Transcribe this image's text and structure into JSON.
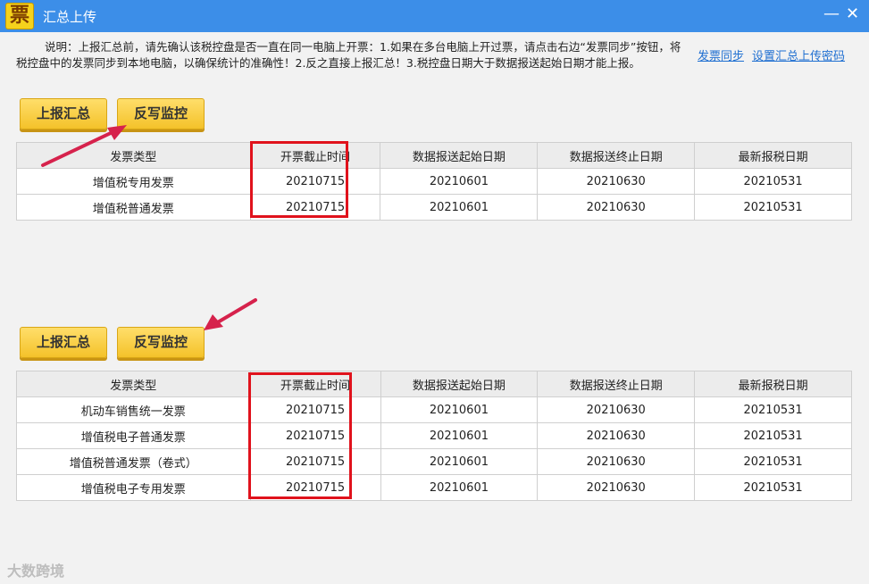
{
  "window": {
    "icon_glyph": "票",
    "title": "汇总上传",
    "minimize_glyph": "—",
    "close_glyph": "✕"
  },
  "description": "说明：上报汇总前，请先确认该税控盘是否一直在同一电脑上开票：1.如果在多台电脑上开过票，请点击右边“发票同步”按钮，将税控盘中的发票同步到本地电脑，以确保统计的准确性！2.反之直接上报汇总！3.税控盘日期大于数据报送起始日期才能上报。",
  "links": {
    "sync": "发票同步",
    "set_password": "设置汇总上传密码"
  },
  "headers": [
    "发票类型",
    "开票截止时间",
    "数据报送起始日期",
    "数据报送终止日期",
    "最新报税日期"
  ],
  "section1": {
    "report_button": "上报汇总",
    "writeback_button": "反写监控",
    "rows": [
      [
        "增值税专用发票",
        "20210715",
        "20210601",
        "20210630",
        "20210531"
      ],
      [
        "增值税普通发票",
        "20210715",
        "20210601",
        "20210630",
        "20210531"
      ]
    ]
  },
  "section2": {
    "report_button": "上报汇总",
    "writeback_button": "反写监控",
    "rows": [
      [
        "机动车销售统一发票",
        "20210715",
        "20210601",
        "20210630",
        "20210531"
      ],
      [
        "增值税电子普通发票",
        "20210715",
        "20210601",
        "20210630",
        "20210531"
      ],
      [
        "增值税普通发票（卷式）",
        "20210715",
        "20210601",
        "20210630",
        "20210531"
      ],
      [
        "增值税电子专用发票",
        "20210715",
        "20210601",
        "20210630",
        "20210531"
      ]
    ]
  },
  "watermark": "大数跨境",
  "colors": {
    "titlebar": "#3c8ee8",
    "button": "#f4c22a",
    "highlight_box": "#e0121c",
    "annotation_arrow": "#d6224c",
    "link": "#1f6fd1"
  }
}
